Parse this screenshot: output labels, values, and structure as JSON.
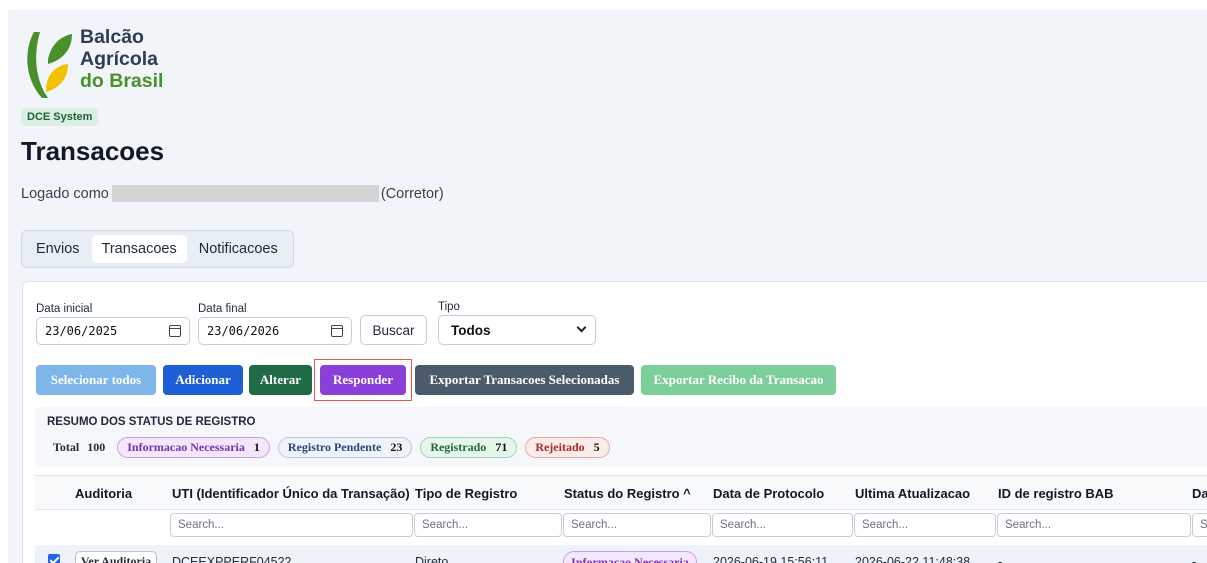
{
  "brand": {
    "line1": "Balcão",
    "line2": "Agrícola",
    "line3": "do Brasil",
    "colors": {
      "leaf_green": "#4a8f2a",
      "leaf_yellow": "#f2c200",
      "text_dark": "#2d3f4f"
    }
  },
  "system_badge": "DCE System",
  "page_title": "Transacoes",
  "logged_in": {
    "prefix": "Logado como",
    "role": "(Corretor)"
  },
  "tabs": [
    {
      "label": "Envios",
      "active": false
    },
    {
      "label": "Transacoes",
      "active": true
    },
    {
      "label": "Notificacoes",
      "active": false
    }
  ],
  "filters": {
    "start_label": "Data inicial",
    "start_value": "23/06/2025",
    "end_label": "Data final",
    "end_value": "23/06/2026",
    "search_button": "Buscar",
    "type_label": "Tipo",
    "type_value": "Todos"
  },
  "actions": {
    "select_all": "Selecionar todos",
    "add": "Adicionar",
    "edit": "Alterar",
    "respond": "Responder",
    "export_selected": "Exportar Transacoes Selecionadas",
    "export_receipt": "Exportar Recibo da Transacao"
  },
  "summary": {
    "title": "RESUMO DOS STATUS DE REGISTRO",
    "total_label": "Total",
    "total_value": "100",
    "chips": [
      {
        "label": "Informacao Necessaria",
        "count": "1"
      },
      {
        "label": "Registro Pendente",
        "count": "23"
      },
      {
        "label": "Registrado",
        "count": "71"
      },
      {
        "label": "Rejeitado",
        "count": "5"
      }
    ]
  },
  "table": {
    "columns": [
      "Auditoria",
      "UTI (Identificador Único da Transação)",
      "Tipo de Registro",
      "Status do Registro ^",
      "Data de Protocolo",
      "Ultima Atualizacao",
      "ID de registro BAB",
      "Da"
    ],
    "search_placeholder": "Search...",
    "search_placeholder_cut": "S",
    "rows": [
      {
        "selected": true,
        "audit_button": "Ver Auditoria",
        "uti": "DCEEXPPERF04522",
        "type": "Direto",
        "status": "Informacao Necessaria",
        "protocol_date": "2026-06-19 15:56:11",
        "last_update": "2026-06-22 11:48:38",
        "bab_id": "-",
        "last": "-"
      }
    ]
  }
}
